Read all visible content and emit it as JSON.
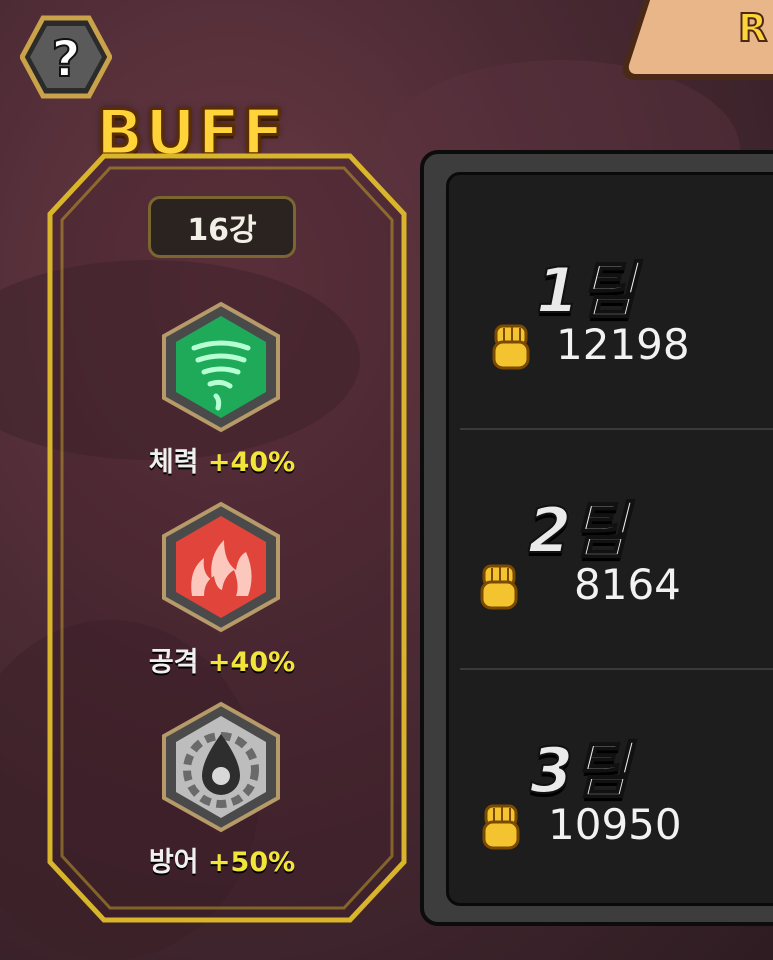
{
  "header": {
    "help_label": "?",
    "buff_title": "BUFF",
    "rank_tab_text": "R"
  },
  "buff_panel": {
    "round": "16강",
    "buffs": [
      {
        "name": "체력",
        "value": "+40%",
        "icon": "tornado-icon",
        "color": "#2fd07a"
      },
      {
        "name": "공격",
        "value": "+40%",
        "icon": "flame-icon",
        "color": "#e8443a"
      },
      {
        "name": "방어",
        "value": "+50%",
        "icon": "shield-drop-icon",
        "color": "#bfbfbf"
      }
    ]
  },
  "teams": [
    {
      "name": "1팀",
      "power": "12198",
      "icon": "fist-icon"
    },
    {
      "name": "2팀",
      "power": "8164",
      "icon": "fist-icon"
    },
    {
      "name": "3팀",
      "power": "10950",
      "icon": "fist-icon"
    }
  ],
  "colors": {
    "title_gold": "#ffd33a",
    "buff_value": "#f2e53a",
    "panel_border": "#d8b52a"
  }
}
